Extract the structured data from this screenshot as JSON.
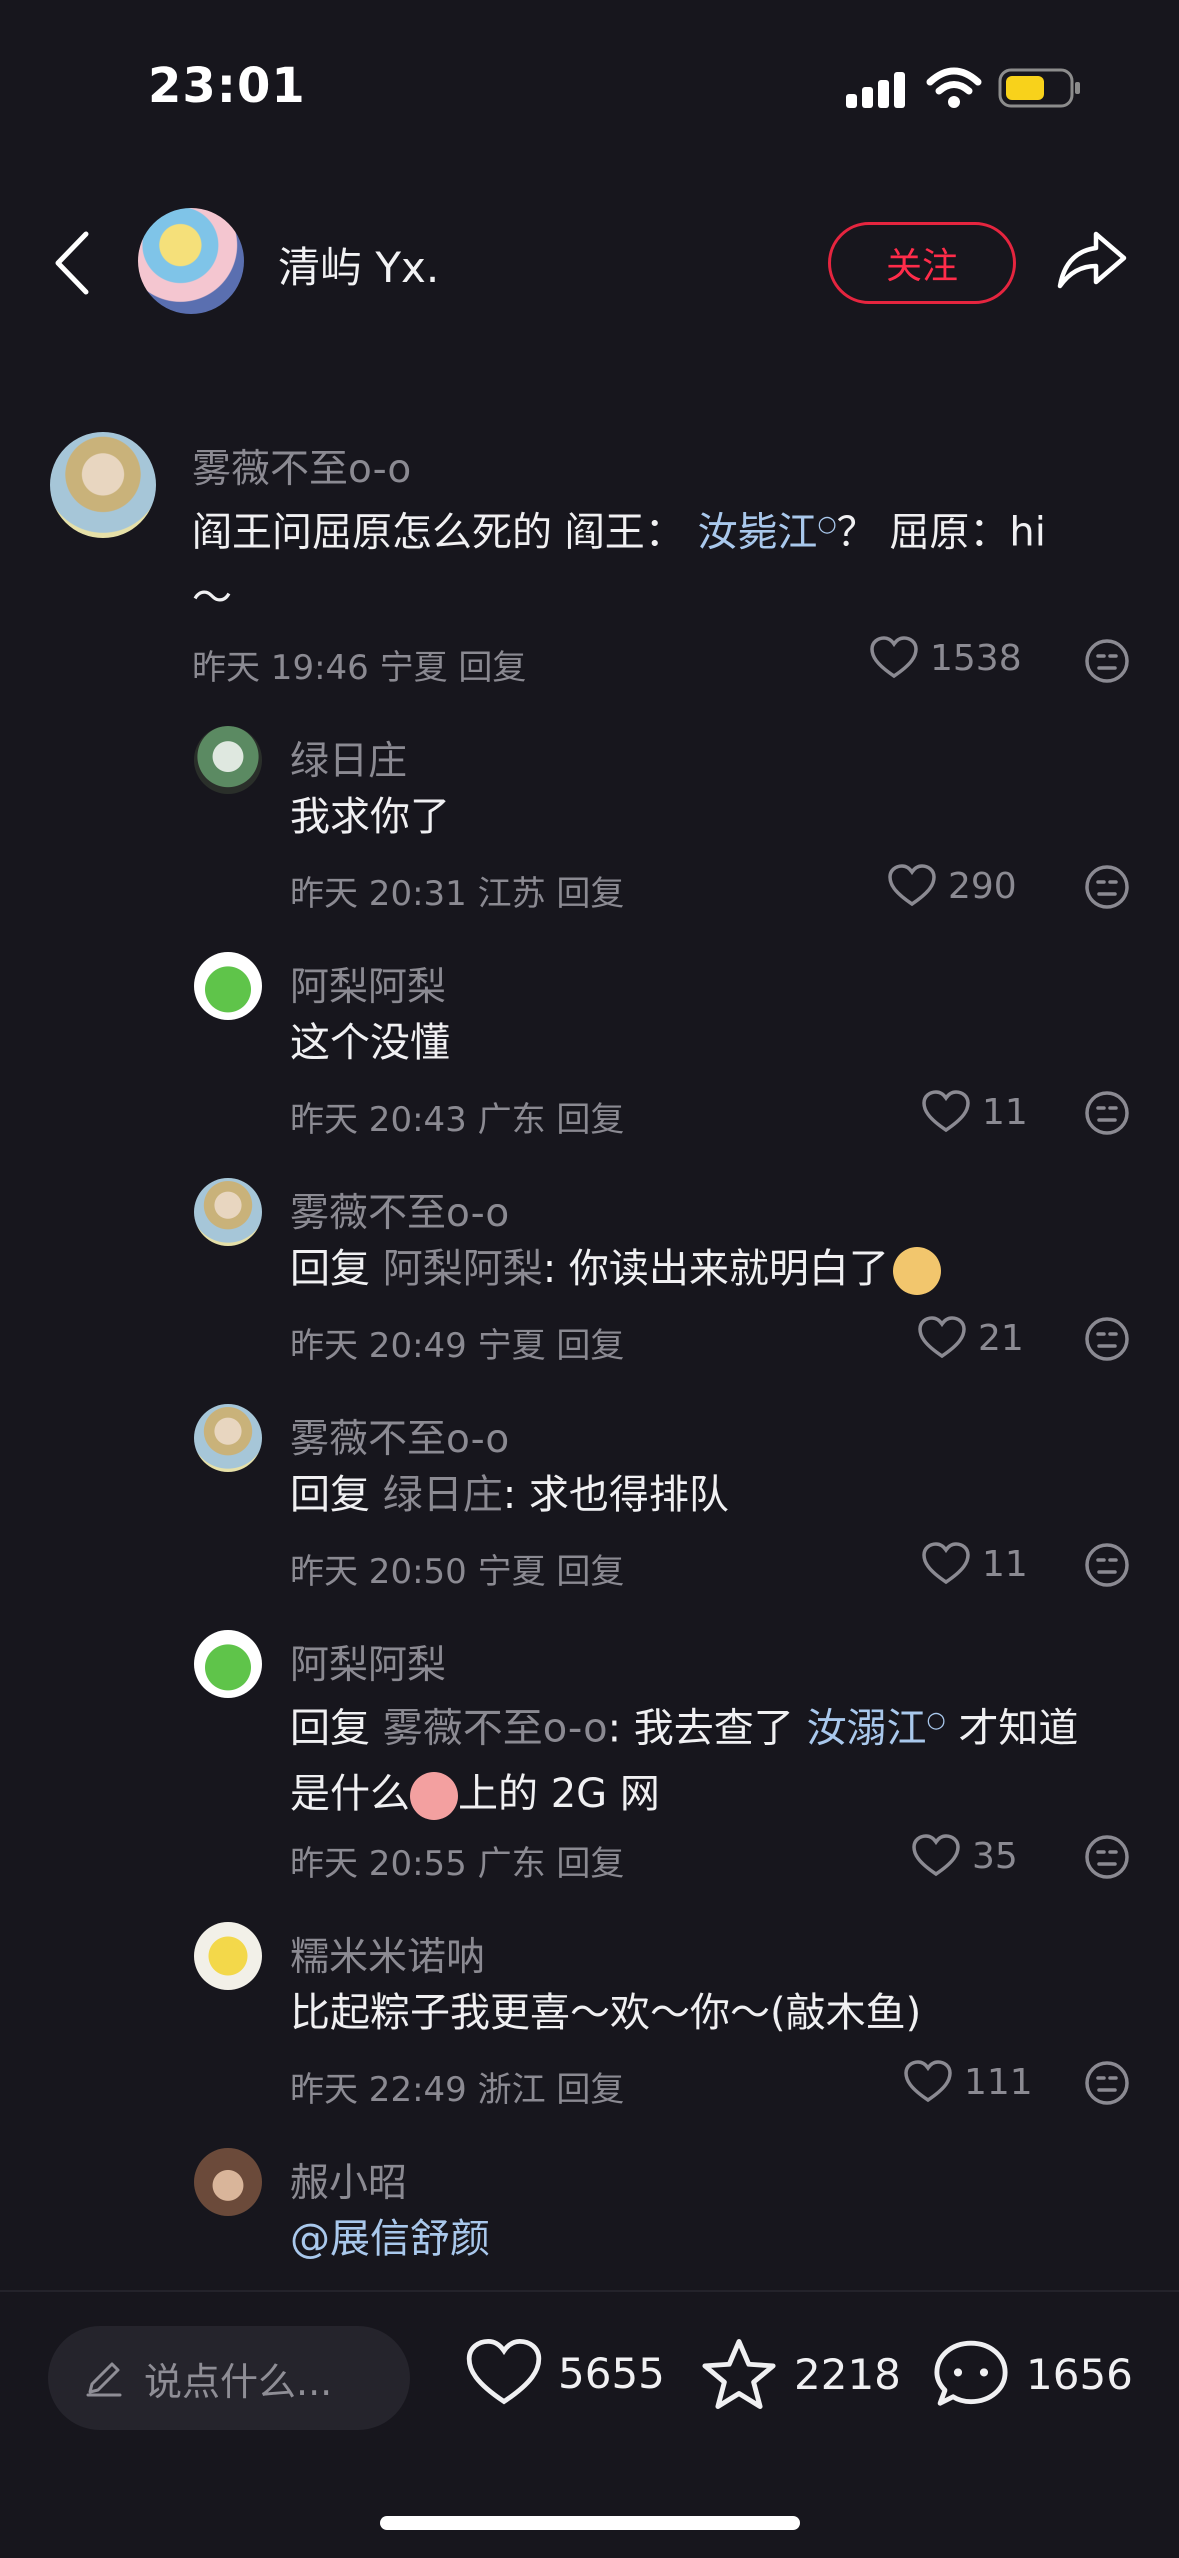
{
  "status_bar": {
    "time": "23:01"
  },
  "header": {
    "author_name": "清屿 Yx.",
    "follow_label": "关注"
  },
  "comments": [
    {
      "user": "雾薇不至o-o",
      "text": "阎王问屈原怎么死的 阎王：",
      "link": "汝毙江",
      "text_after": "？ 屈原：hi",
      "text_line2": "～",
      "time": "昨天 19:46",
      "location": "宁夏",
      "reply_label": "回复",
      "likes": "1538"
    },
    {
      "user": "绿日庄",
      "text": "我求你了",
      "time": "昨天 20:31",
      "location": "江苏",
      "reply_label": "回复",
      "likes": "290"
    },
    {
      "user": "阿梨阿梨",
      "text": "这个没懂",
      "time": "昨天 20:43",
      "location": "广东",
      "reply_label": "回复",
      "likes": "11"
    },
    {
      "user": "雾薇不至o-o",
      "reply_prefix": "回复",
      "reply_to": "阿梨阿梨",
      "text": ": 你读出来就明白了",
      "time": "昨天 20:49",
      "location": "宁夏",
      "reply_label": "回复",
      "likes": "21"
    },
    {
      "user": "雾薇不至o-o",
      "reply_prefix": "回复",
      "reply_to": "绿日庄",
      "text": ": 求也得排队",
      "time": "昨天 20:50",
      "location": "宁夏",
      "reply_label": "回复",
      "likes": "11"
    },
    {
      "user": "阿梨阿梨",
      "reply_prefix": "回复",
      "reply_to": "雾薇不至o-o",
      "text": ": 我去查了",
      "link": "汝溺江",
      "text_after": "才知道",
      "text_line2a": "是什么",
      "text_line2b": "上的 2G 网",
      "time": "昨天 20:55",
      "location": "广东",
      "reply_label": "回复",
      "likes": "35"
    },
    {
      "user": "糯米米诺呐",
      "text": "比起粽子我更喜～欢～你～(敲木鱼)",
      "time": "昨天 22:49",
      "location": "浙江",
      "reply_label": "回复",
      "likes": "111"
    },
    {
      "user": "赧小昭",
      "text": "@展信舒颜"
    }
  ],
  "bottom_bar": {
    "input_placeholder": "说点什么...",
    "likes": "5655",
    "favorites": "2218",
    "comments": "1656"
  },
  "colors": {
    "background": "#17161d",
    "follow_red": "#e5253f",
    "link_blue": "#a9c8ec",
    "muted": "#8b8a92"
  },
  "icons": [
    "back-arrow-icon",
    "share-icon",
    "heart-icon",
    "dislike-face-icon",
    "pencil-icon",
    "star-icon",
    "comment-bubble-icon",
    "search-mini-icon"
  ]
}
